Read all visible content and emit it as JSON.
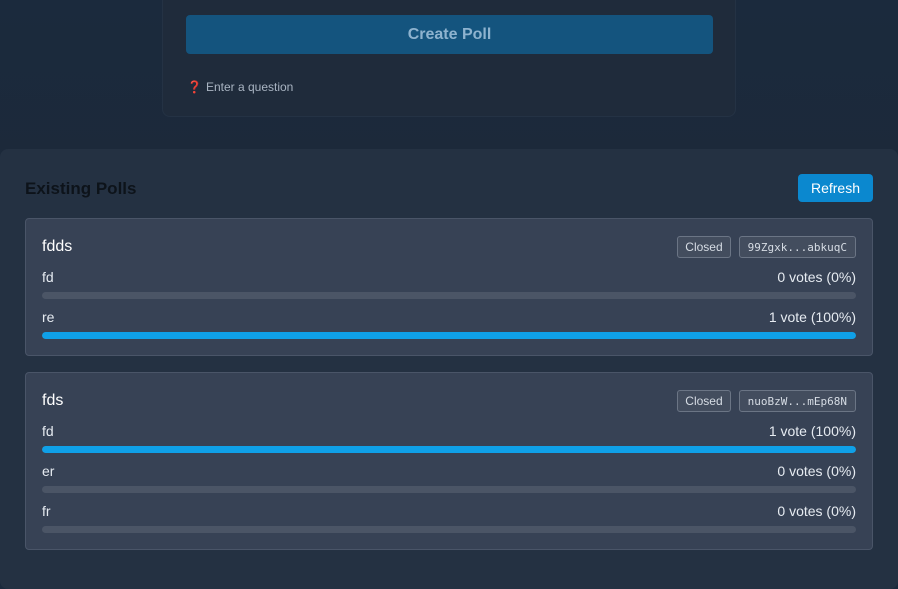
{
  "create_poll": {
    "button_label": "Create Poll",
    "hint_icon": "question-mark-icon",
    "hint_glyph": "❓",
    "hint_text": "Enter a question"
  },
  "existing_polls": {
    "title": "Existing Polls",
    "refresh_label": "Refresh",
    "colors": {
      "accent": "#0b88cf",
      "bar_fill": "#0fa0e8",
      "bar_track": "#4b5566"
    },
    "polls": [
      {
        "title": "fdds",
        "status": "Closed",
        "id": "99Zgxk...abkuqC",
        "options": [
          {
            "label": "fd",
            "votes_text": "0 votes (0%)",
            "percent": 0
          },
          {
            "label": "re",
            "votes_text": "1 vote (100%)",
            "percent": 100
          }
        ]
      },
      {
        "title": "fds",
        "status": "Closed",
        "id": "nuoBzW...mEp68N",
        "options": [
          {
            "label": "fd",
            "votes_text": "1 vote (100%)",
            "percent": 100
          },
          {
            "label": "er",
            "votes_text": "0 votes (0%)",
            "percent": 0
          },
          {
            "label": "fr",
            "votes_text": "0 votes (0%)",
            "percent": 0
          }
        ]
      }
    ]
  }
}
